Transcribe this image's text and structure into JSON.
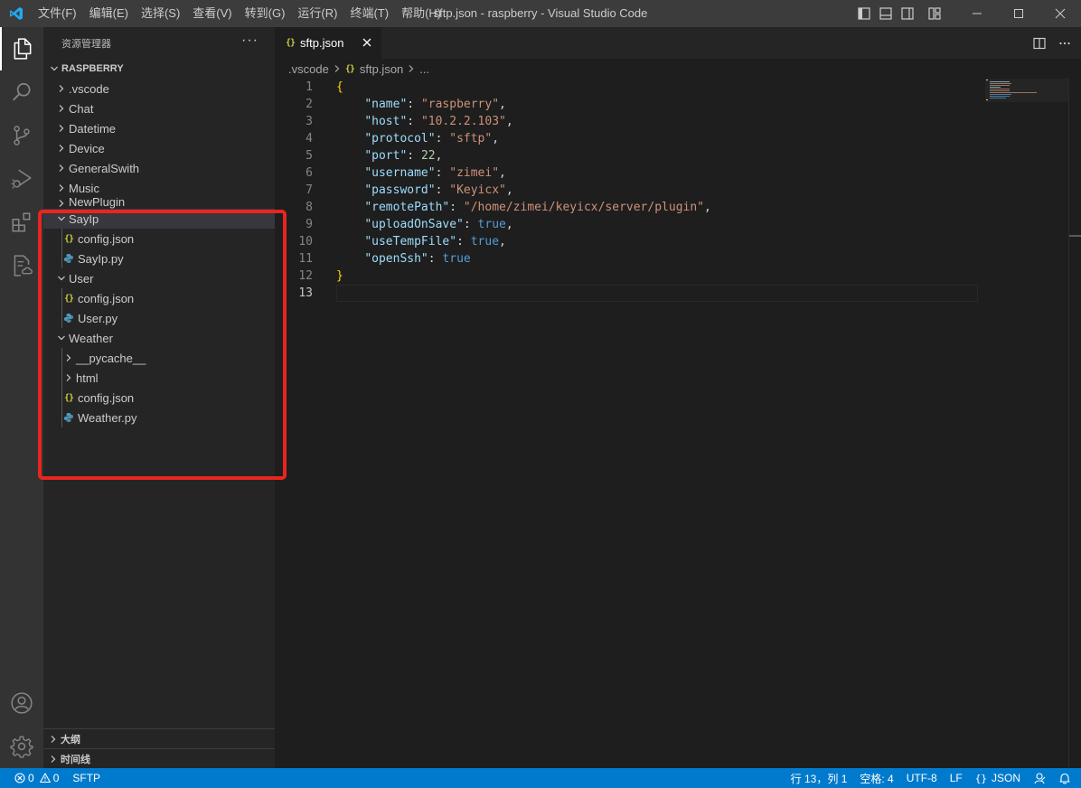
{
  "window": {
    "title": "sftp.json - raspberry - Visual Studio Code",
    "menu": [
      "文件(F)",
      "编辑(E)",
      "选择(S)",
      "查看(V)",
      "转到(G)",
      "运行(R)",
      "终端(T)",
      "帮助(H)"
    ]
  },
  "activity_bar": {
    "top": [
      "files-icon",
      "search-icon",
      "source-control-icon",
      "run-debug-icon",
      "extensions-icon",
      "remote-explorer-icon"
    ],
    "bottom": [
      "account-icon",
      "gear-icon"
    ]
  },
  "explorer": {
    "header": "资源管理器",
    "more": "···",
    "root": "RASPBERRY",
    "items": [
      {
        "label": ".vscode",
        "kind": "folder",
        "open": false,
        "depth": 0
      },
      {
        "label": "Chat",
        "kind": "folder",
        "open": false,
        "depth": 0
      },
      {
        "label": "Datetime",
        "kind": "folder",
        "open": false,
        "depth": 0
      },
      {
        "label": "Device",
        "kind": "folder",
        "open": false,
        "depth": 0
      },
      {
        "label": "GeneralSwith",
        "kind": "folder",
        "open": false,
        "depth": 0
      },
      {
        "label": "Music",
        "kind": "folder",
        "open": false,
        "depth": 0
      },
      {
        "label": "NewPlugin",
        "kind": "folder",
        "open": false,
        "depth": 0,
        "clipped": true
      },
      {
        "label": "SayIp",
        "kind": "folder",
        "open": true,
        "depth": 0,
        "selected": true
      },
      {
        "label": "config.json",
        "kind": "json",
        "depth": 1
      },
      {
        "label": "SayIp.py",
        "kind": "python",
        "depth": 1
      },
      {
        "label": "User",
        "kind": "folder",
        "open": true,
        "depth": 0
      },
      {
        "label": "config.json",
        "kind": "json",
        "depth": 1
      },
      {
        "label": "User.py",
        "kind": "python",
        "depth": 1
      },
      {
        "label": "Weather",
        "kind": "folder",
        "open": true,
        "depth": 0
      },
      {
        "label": "__pycache__",
        "kind": "folder",
        "open": false,
        "depth": 1
      },
      {
        "label": "html",
        "kind": "folder",
        "open": false,
        "depth": 1
      },
      {
        "label": "config.json",
        "kind": "json",
        "depth": 1
      },
      {
        "label": "Weather.py",
        "kind": "python",
        "depth": 1
      }
    ],
    "sections": [
      "大纲",
      "时间线"
    ]
  },
  "tab": {
    "label": "sftp.json"
  },
  "breadcrumb": {
    "folder": ".vscode",
    "file": "sftp.json",
    "tail": "..."
  },
  "editor": {
    "lines": [
      [
        [
          "{",
          "br"
        ]
      ],
      [
        [
          "    ",
          "p"
        ],
        [
          "\"name\"",
          "k"
        ],
        [
          ": ",
          "p"
        ],
        [
          "\"raspberry\"",
          "s"
        ],
        [
          ",",
          "p"
        ]
      ],
      [
        [
          "    ",
          "p"
        ],
        [
          "\"host\"",
          "k"
        ],
        [
          ": ",
          "p"
        ],
        [
          "\"10.2.2.103\"",
          "s"
        ],
        [
          ",",
          "p"
        ]
      ],
      [
        [
          "    ",
          "p"
        ],
        [
          "\"protocol\"",
          "k"
        ],
        [
          ": ",
          "p"
        ],
        [
          "\"sftp\"",
          "s"
        ],
        [
          ",",
          "p"
        ]
      ],
      [
        [
          "    ",
          "p"
        ],
        [
          "\"port\"",
          "k"
        ],
        [
          ": ",
          "p"
        ],
        [
          "22",
          "n"
        ],
        [
          ",",
          "p"
        ]
      ],
      [
        [
          "    ",
          "p"
        ],
        [
          "\"username\"",
          "k"
        ],
        [
          ": ",
          "p"
        ],
        [
          "\"zimei\"",
          "s"
        ],
        [
          ",",
          "p"
        ]
      ],
      [
        [
          "    ",
          "p"
        ],
        [
          "\"password\"",
          "k"
        ],
        [
          ": ",
          "p"
        ],
        [
          "\"Keyicx\"",
          "s"
        ],
        [
          ",",
          "p"
        ]
      ],
      [
        [
          "    ",
          "p"
        ],
        [
          "\"remotePath\"",
          "k"
        ],
        [
          ": ",
          "p"
        ],
        [
          "\"/home/zimei/keyicx/server/plugin\"",
          "s"
        ],
        [
          ",",
          "p"
        ]
      ],
      [
        [
          "    ",
          "p"
        ],
        [
          "\"uploadOnSave\"",
          "k"
        ],
        [
          ": ",
          "p"
        ],
        [
          "true",
          "b"
        ],
        [
          ",",
          "p"
        ]
      ],
      [
        [
          "    ",
          "p"
        ],
        [
          "\"useTempFile\"",
          "k"
        ],
        [
          ": ",
          "p"
        ],
        [
          "true",
          "b"
        ],
        [
          ",",
          "p"
        ]
      ],
      [
        [
          "    ",
          "p"
        ],
        [
          "\"openSsh\"",
          "k"
        ],
        [
          ": ",
          "p"
        ],
        [
          "true",
          "b"
        ]
      ],
      [
        [
          "}",
          "br"
        ]
      ],
      []
    ],
    "current_line": 13
  },
  "status": {
    "errors": "0",
    "warnings": "0",
    "sftp": "SFTP",
    "position": "行 13，列 1",
    "spaces": "空格: 4",
    "encoding": "UTF-8",
    "eol": "LF",
    "language": "JSON"
  },
  "colors": {
    "accent": "#007acc",
    "highlight_box": "#e8251f",
    "json_icon": "#cbcb41",
    "python_icon": "#519aba"
  }
}
